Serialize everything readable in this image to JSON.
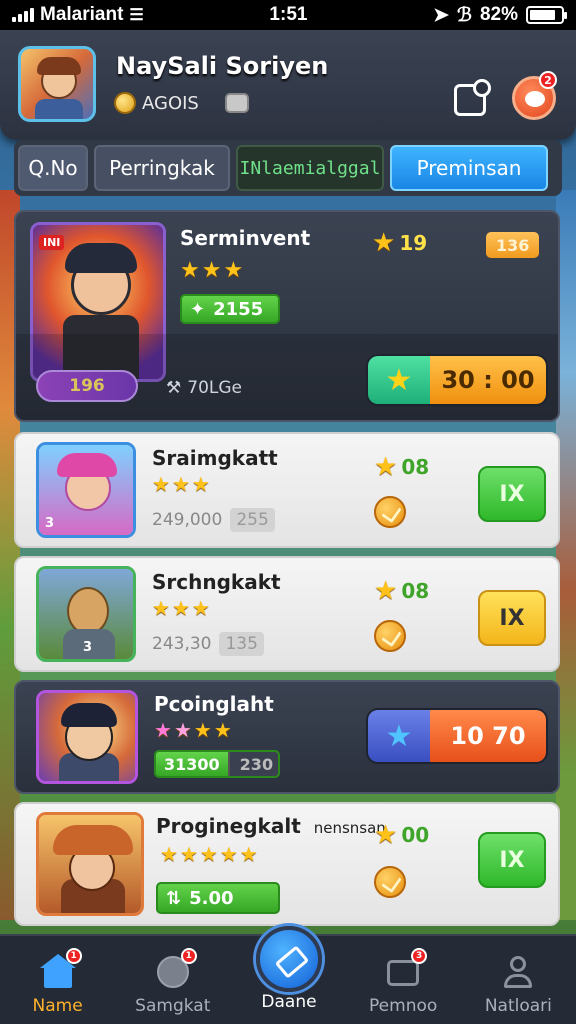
{
  "status_bar": {
    "carrier": "Malariant",
    "time": "1:51",
    "battery": "82%",
    "battery_level": 0.82
  },
  "header": {
    "username": "NaySali Soriyen",
    "coins": "AGOIS",
    "notifications_count": "2"
  },
  "tabs": [
    {
      "label": "Q.No"
    },
    {
      "label": "Perringkak"
    },
    {
      "label": "INlaemialggal"
    },
    {
      "label": "Preminsan"
    }
  ],
  "cards": [
    {
      "title": "Serminvent",
      "stars": 3,
      "rating": "19",
      "price_tag": "136",
      "green_value": "2155",
      "level": "196",
      "meta": "70LGe",
      "action": "30 : 00",
      "thumb_label": "INI"
    },
    {
      "title": "Sraimgkatt",
      "stars": 3,
      "rating": "08",
      "sub_value": "249,000",
      "sub_chip": "255",
      "action": "IX",
      "thumb_label": "3"
    },
    {
      "title": "Srchngkakt",
      "stars": 3,
      "rating": "08",
      "sub_value": "243,30",
      "sub_chip": "135",
      "action": "IX",
      "thumb_label": "3"
    },
    {
      "title": "Pcoinglaht",
      "stars": 4,
      "green_value": "31300",
      "green_tail": "230",
      "action": "10 70"
    },
    {
      "title": "Proginegkalt",
      "title_suffix": "nensnsan",
      "stars": 5,
      "rating": "00",
      "green_value": "5.00",
      "action": "IX"
    }
  ],
  "bottom_nav": [
    {
      "label": "Name",
      "badge": "1"
    },
    {
      "label": "Samgkat",
      "badge": "1"
    },
    {
      "label": "Daane"
    },
    {
      "label": "Pemnoo",
      "badge": "3"
    },
    {
      "label": "Natloari"
    }
  ],
  "colors": {
    "accent_blue": "#1a86e6",
    "accent_green": "#35a726",
    "accent_orange": "#f09a1e",
    "notification_red": "#e22222"
  }
}
